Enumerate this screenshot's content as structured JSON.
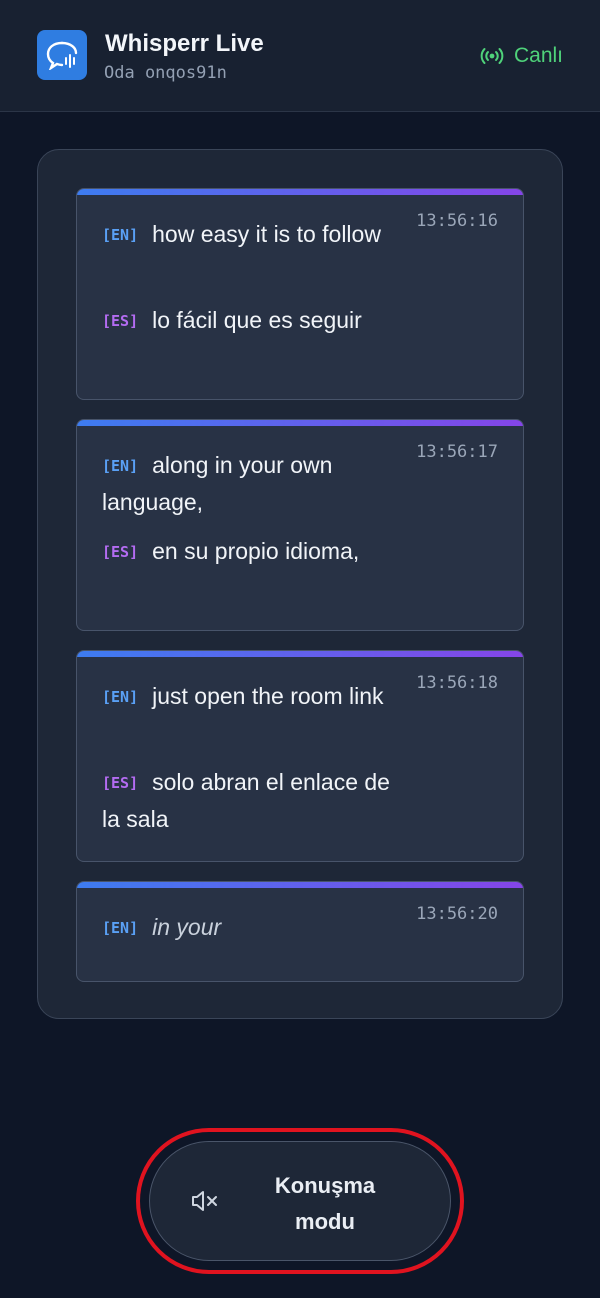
{
  "header": {
    "title": "Whisperr Live",
    "room": "Oda onqos91n",
    "status": "Canlı"
  },
  "colors": {
    "accent": "#2f7de1",
    "live": "#4fd27a",
    "lang_en": "#5aa0f5",
    "lang_es": "#b46cf2",
    "highlight": "#e0131f"
  },
  "messages": [
    {
      "time": "13:56:16",
      "source_tag": "[EN]",
      "source_text": "how easy it is to follow",
      "target_tag": "[ES]",
      "target_text": "lo fácil que es seguir"
    },
    {
      "time": "13:56:17",
      "source_tag": "[EN]",
      "source_text": "along in your own language,",
      "target_tag": "[ES]",
      "target_text": "en su propio idioma,"
    },
    {
      "time": "13:56:18",
      "source_tag": "[EN]",
      "source_text": "just open the room link",
      "target_tag": "[ES]",
      "target_text": "solo abran el enlace de la sala"
    },
    {
      "time": "13:56:20",
      "source_tag": "[EN]",
      "source_text": "in your"
    }
  ],
  "controls": {
    "mode_label": "Konuşma modu",
    "mode_icon": "speaker-muted-icon"
  }
}
